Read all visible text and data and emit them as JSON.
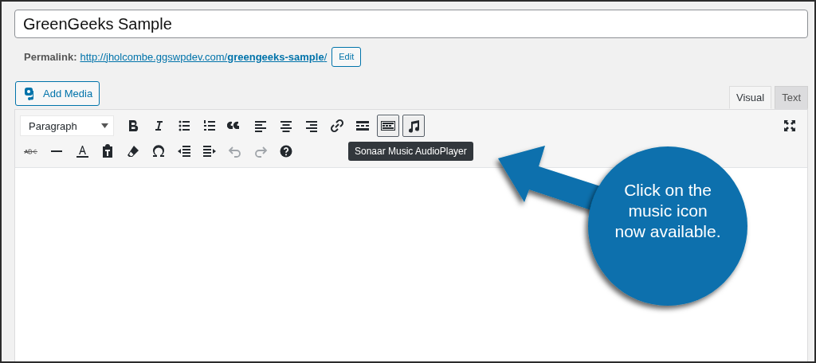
{
  "title_field": {
    "value": "GreenGeeks Sample"
  },
  "permalink": {
    "label": "Permalink:",
    "url_prefix": "http://jholcombe.ggswpdev.com/",
    "slug": "greengeeks-sample",
    "url_suffix": "/",
    "edit_button": "Edit"
  },
  "add_media_button": "Add Media",
  "tabs": [
    {
      "label": "Visual",
      "selected": true
    },
    {
      "label": "Text",
      "selected": false
    }
  ],
  "format_select": {
    "value": "Paragraph"
  },
  "toolbar_rows": [
    [
      {
        "kind": "bold",
        "pressed": false
      },
      {
        "kind": "italic",
        "pressed": false
      },
      {
        "kind": "bullets",
        "pressed": false
      },
      {
        "kind": "numbers",
        "pressed": false
      },
      {
        "kind": "quote",
        "pressed": false
      },
      {
        "kind": "align-left",
        "pressed": false
      },
      {
        "kind": "align-center",
        "pressed": false
      },
      {
        "kind": "align-right",
        "pressed": false
      },
      {
        "kind": "link",
        "pressed": false
      },
      {
        "kind": "more",
        "pressed": false
      },
      {
        "kind": "toggle",
        "pressed": true
      },
      {
        "kind": "music",
        "pressed": true
      }
    ],
    [
      {
        "kind": "strike",
        "pressed": false
      },
      {
        "kind": "hr",
        "pressed": false
      },
      {
        "kind": "color",
        "pressed": false
      },
      {
        "kind": "paste",
        "pressed": false
      },
      {
        "kind": "eraser",
        "pressed": false
      },
      {
        "kind": "omega",
        "pressed": false
      },
      {
        "kind": "outdent",
        "pressed": false
      },
      {
        "kind": "indent",
        "pressed": false
      },
      {
        "kind": "undo",
        "disabled": true
      },
      {
        "kind": "redo",
        "disabled": true
      },
      {
        "kind": "help",
        "pressed": false
      }
    ]
  ],
  "tooltip": "Sonaar Music AudioPlayer",
  "callout": {
    "text": "Click on the music icon now available."
  }
}
